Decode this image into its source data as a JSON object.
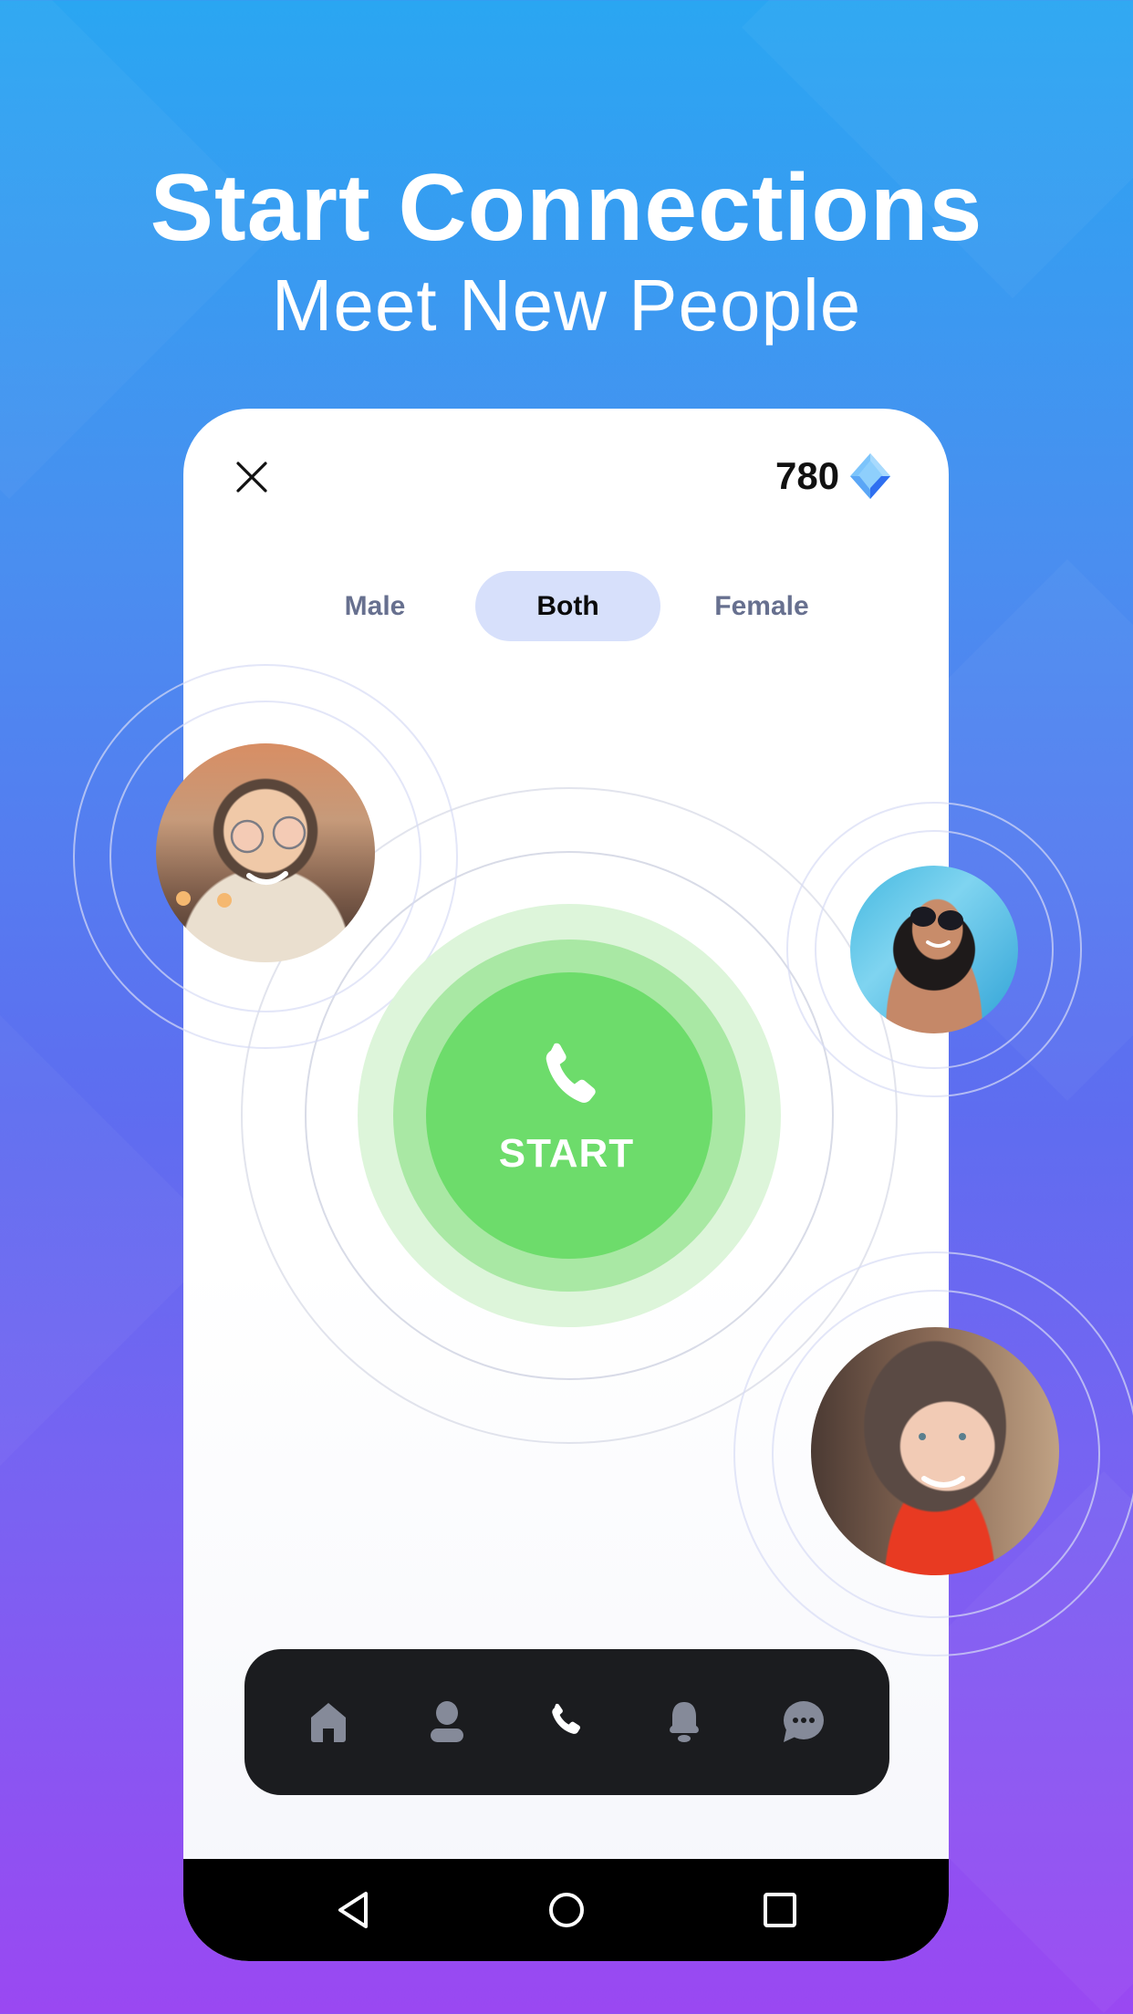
{
  "hero": {
    "title": "Start Connections",
    "subtitle": "Meet New People"
  },
  "header": {
    "close_icon": "close-icon",
    "balance": "780",
    "currency_icon": "diamond-gem-icon"
  },
  "gender_filter": {
    "options": [
      {
        "label": "Male",
        "selected": false
      },
      {
        "label": "Both",
        "selected": true
      },
      {
        "label": "Female",
        "selected": false
      }
    ]
  },
  "start_button": {
    "label": "START",
    "icon": "phone-icon"
  },
  "avatars": [
    {
      "description": "Smiling young man with glasses"
    },
    {
      "description": "Smiling woman with sunglasses at pool"
    },
    {
      "description": "Smiling woman with long brown hair in red top"
    }
  ],
  "tab_bar": {
    "items": [
      {
        "icon": "home-icon",
        "active": false
      },
      {
        "icon": "profile-icon",
        "active": false
      },
      {
        "icon": "phone-icon",
        "active": true
      },
      {
        "icon": "bell-icon",
        "active": false
      },
      {
        "icon": "chat-icon",
        "active": false
      }
    ]
  },
  "system_nav": {
    "items": [
      "back-icon",
      "home-circle-icon",
      "recents-icon"
    ]
  },
  "colors": {
    "accent_green": "#6ddc6b",
    "tab_active_bg": "#d7e0fb",
    "tabbar_bg": "#1b1c1f",
    "icon_inactive": "#858a99"
  }
}
